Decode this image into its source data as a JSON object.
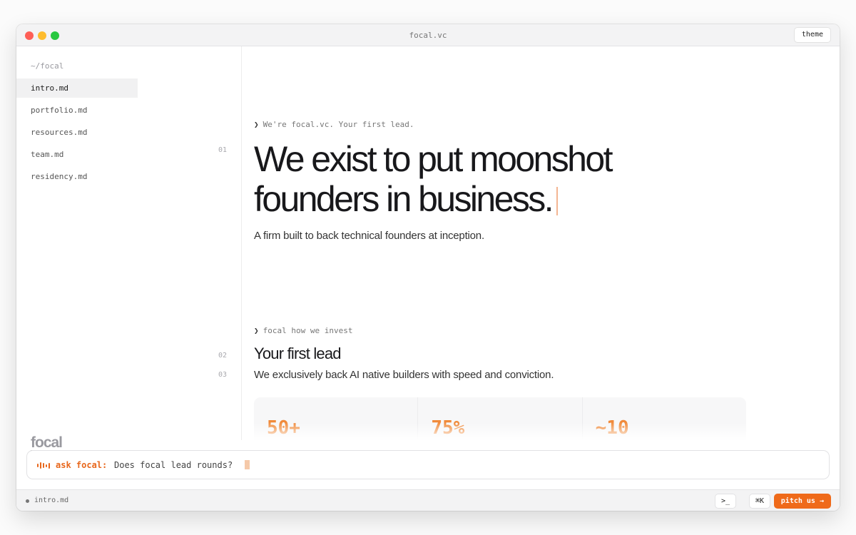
{
  "window": {
    "title": "focal.vc",
    "theme_label": "theme"
  },
  "sidebar": {
    "root": "~/focal",
    "items": [
      {
        "label": "intro.md",
        "active": true
      },
      {
        "label": "portfolio.md"
      },
      {
        "label": "resources.md"
      },
      {
        "label": "team.md"
      },
      {
        "label": "residency.md"
      }
    ],
    "logo_text": "focal"
  },
  "gutter": {
    "line_01": "01",
    "line_02": "02",
    "line_03": "03"
  },
  "main": {
    "intro_prompt": "We're focal.vc. Your first lead.",
    "prompt_glyph": "❯",
    "headline": "We exist to put moonshot founders in business.",
    "subhead": "A firm built to back technical founders at inception.",
    "section_prompt": "focal how we invest",
    "section_title": "Your first lead",
    "section_body": "We exclusively back AI native builders with speed and conviction.",
    "stats": [
      "50+",
      "75%",
      "~10"
    ]
  },
  "ask": {
    "label": "ask focal:",
    "value": "Does focal lead rounds?",
    "icon": "waveform-icon"
  },
  "statusbar": {
    "file": "intro.md",
    "terminal_label": ">_",
    "shortcut_label": "⌘K",
    "pitch_label": "pitch us →"
  },
  "colors": {
    "accent": "#ef6a1a",
    "stat": "#f08a3a",
    "caret": "#f4b592"
  }
}
